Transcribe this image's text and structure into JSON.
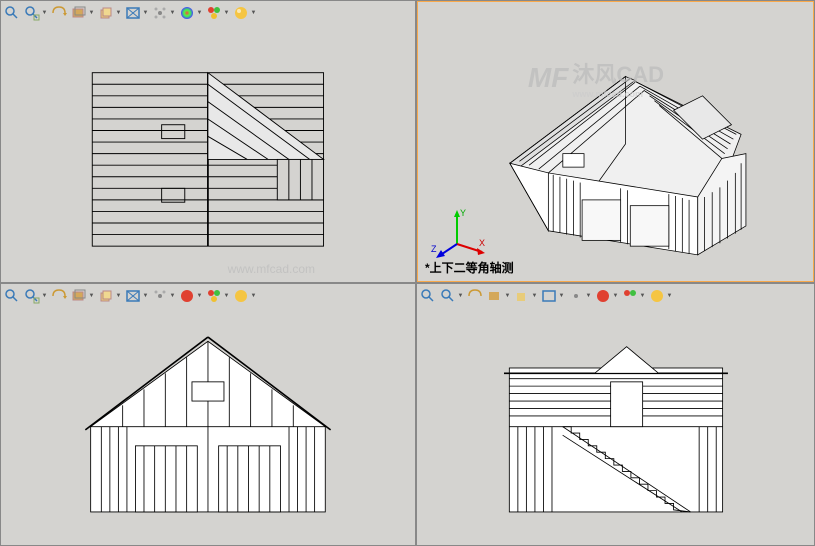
{
  "app": {
    "watermark_brand": "沐风CAD",
    "watermark_url": "www.mfcad.com",
    "watermark_center": "www.mfcad.com"
  },
  "viewports": {
    "top_left": {
      "label": ""
    },
    "top_right": {
      "label": "*上下二等角轴测"
    },
    "bottom_left": {
      "label": ""
    },
    "bottom_right": {
      "label": ""
    }
  },
  "toolbar_icons": [
    "zoom-to-fit-icon",
    "zoom-area-icon",
    "rotate-view-icon",
    "section-icon",
    "display-style-icon",
    "hide-show-icon",
    "edit-scene-icon",
    "apply-scene-icon",
    "view-settings-icon",
    "render-icon"
  ],
  "axis": {
    "x": "X",
    "y": "Y",
    "z": "Z"
  }
}
